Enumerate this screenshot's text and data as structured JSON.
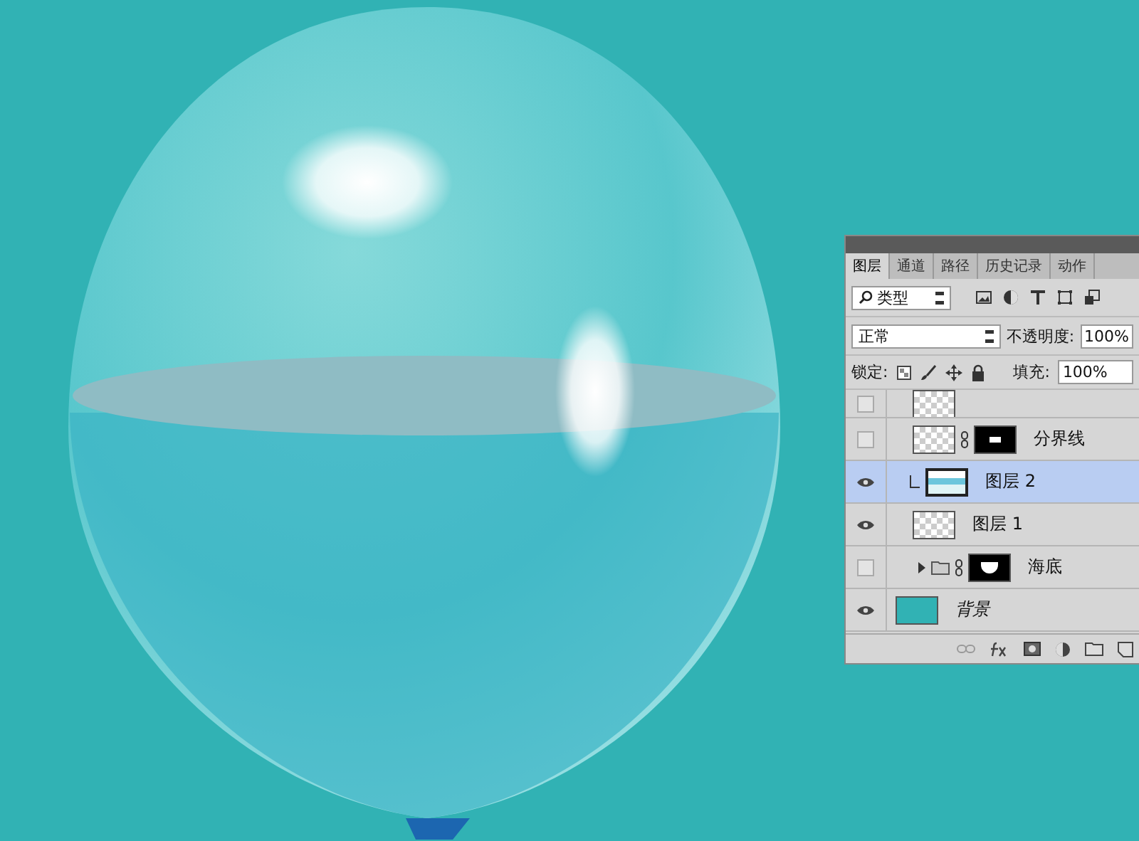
{
  "tabs": [
    {
      "label": "图层",
      "selected": true
    },
    {
      "label": "通道",
      "selected": false
    },
    {
      "label": "路径",
      "selected": false
    },
    {
      "label": "历史记录",
      "selected": false
    },
    {
      "label": "动作",
      "selected": false
    }
  ],
  "filter": {
    "value": "类型"
  },
  "blend_mode": {
    "value": "正常"
  },
  "opacity": {
    "label": "不透明度:",
    "value": "100%"
  },
  "lock": {
    "label": "锁定:"
  },
  "fill": {
    "label": "填充:",
    "value": "100%"
  },
  "layers": [
    {
      "kind": "cut-off",
      "visible": false,
      "selected": false
    },
    {
      "kind": "layer",
      "name": "分界线",
      "visible": false,
      "selected": false,
      "clipped": false,
      "mask": true
    },
    {
      "kind": "layer",
      "name": "图层 2",
      "visible": true,
      "selected": true,
      "clipped": true,
      "mask": false
    },
    {
      "kind": "layer",
      "name": "图层 1",
      "visible": true,
      "selected": false,
      "clipped": false,
      "mask": false
    },
    {
      "kind": "group",
      "name": "海底",
      "visible": false,
      "selected": false,
      "clipped": false,
      "mask": true
    },
    {
      "kind": "background",
      "name": "背景",
      "visible": true,
      "selected": false,
      "clipped": false,
      "mask": false
    }
  ]
}
